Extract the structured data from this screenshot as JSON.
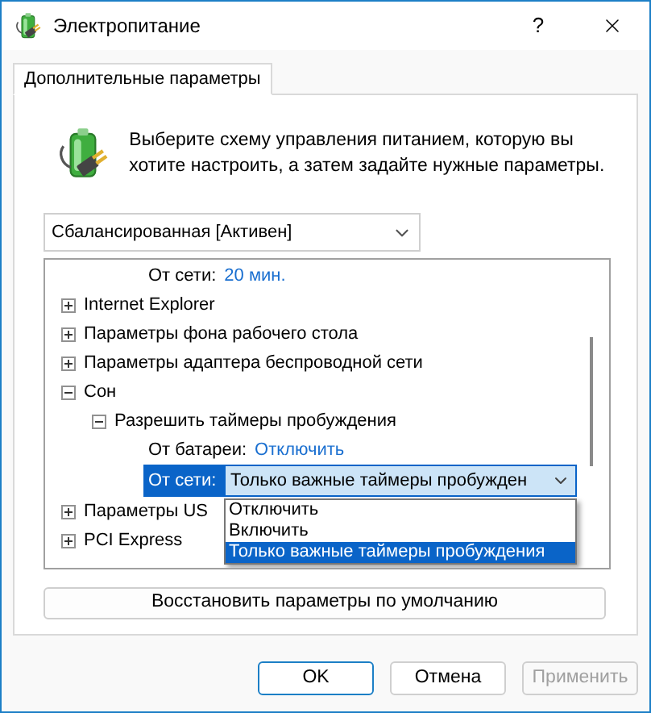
{
  "window": {
    "title": "Электропитание",
    "help": "?"
  },
  "tabs": [
    {
      "label": "Дополнительные параметры",
      "selected": true
    }
  ],
  "intro": "Выберите схему управления питанием, которую вы хотите настроить, а затем задайте нужные параметры.",
  "plan_select": {
    "value": "Сбалансированная [Активен]"
  },
  "tree": {
    "items": [
      {
        "kind": "setting",
        "label": "От сети:",
        "value": "20 мин."
      },
      {
        "kind": "group",
        "label": "Internet Explorer",
        "expanded": false
      },
      {
        "kind": "group",
        "label": "Параметры фона рабочего стола",
        "expanded": false
      },
      {
        "kind": "group",
        "label": "Параметры адаптера беспроводной сети",
        "expanded": false
      },
      {
        "kind": "group",
        "label": "Сон",
        "expanded": true,
        "children": [
          {
            "kind": "group",
            "label": "Разрешить таймеры пробуждения",
            "expanded": true,
            "children": [
              {
                "kind": "setting",
                "label": "От батареи:",
                "value": "Отключить"
              },
              {
                "kind": "select",
                "label": "От сети:",
                "selected": true,
                "value": "Только важные таймеры пробужден",
                "options": [
                  {
                    "label": "Отключить",
                    "selected": false
                  },
                  {
                    "label": "Включить",
                    "selected": false
                  },
                  {
                    "label": "Только важные таймеры пробуждения",
                    "selected": true
                  }
                ]
              }
            ]
          }
        ]
      },
      {
        "kind": "group",
        "label": "Параметры US",
        "expanded": false
      },
      {
        "kind": "group",
        "label": "PCI Express",
        "expanded": false
      }
    ]
  },
  "restore_button": "Восстановить параметры по умолчанию",
  "buttons": [
    {
      "label": "OK",
      "disabled": false,
      "default": true
    },
    {
      "label": "Отмена",
      "disabled": false,
      "default": false
    },
    {
      "label": "Применить",
      "disabled": true,
      "default": false
    }
  ]
}
